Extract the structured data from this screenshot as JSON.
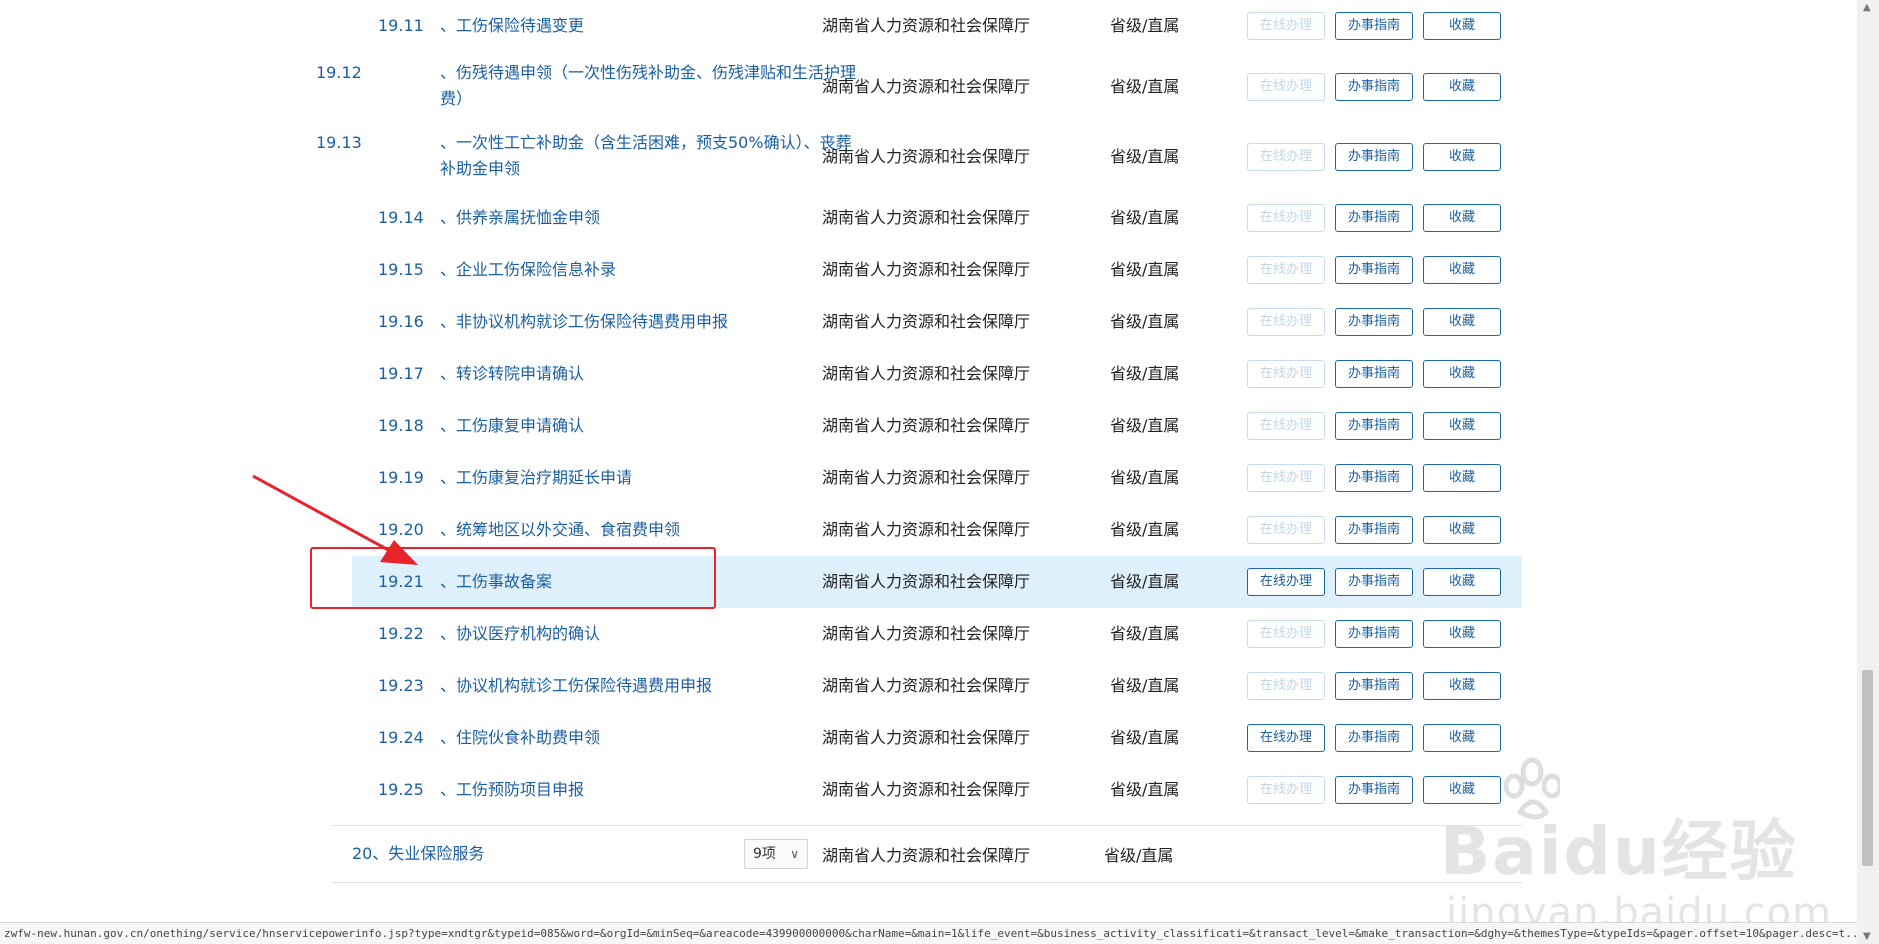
{
  "rows": [
    {
      "num": "19.11",
      "name": "、工伤保险待遇变更",
      "dept": "湖南省人力资源和社会保障厅",
      "level": "省级/直属",
      "online": "在线办理",
      "online_enabled": false,
      "guide": "办事指南",
      "fav": "收藏"
    },
    {
      "num": "19.12",
      "name": "、伤残待遇申领（一次性伤残补助金、伤残津贴和生活护理费）",
      "dept": "湖南省人力资源和社会保障厅",
      "level": "省级/直属",
      "online": "在线办理",
      "online_enabled": false,
      "guide": "办事指南",
      "fav": "收藏"
    },
    {
      "num": "19.13",
      "name": "、一次性工亡补助金（含生活困难，预支50%确认）、丧葬补助金申领",
      "dept": "湖南省人力资源和社会保障厅",
      "level": "省级/直属",
      "online": "在线办理",
      "online_enabled": false,
      "guide": "办事指南",
      "fav": "收藏"
    },
    {
      "num": "19.14",
      "name": "、供养亲属抚恤金申领",
      "dept": "湖南省人力资源和社会保障厅",
      "level": "省级/直属",
      "online": "在线办理",
      "online_enabled": false,
      "guide": "办事指南",
      "fav": "收藏"
    },
    {
      "num": "19.15",
      "name": "、企业工伤保险信息补录",
      "dept": "湖南省人力资源和社会保障厅",
      "level": "省级/直属",
      "online": "在线办理",
      "online_enabled": false,
      "guide": "办事指南",
      "fav": "收藏"
    },
    {
      "num": "19.16",
      "name": "、非协议机构就诊工伤保险待遇费用申报",
      "dept": "湖南省人力资源和社会保障厅",
      "level": "省级/直属",
      "online": "在线办理",
      "online_enabled": false,
      "guide": "办事指南",
      "fav": "收藏"
    },
    {
      "num": "19.17",
      "name": "、转诊转院申请确认",
      "dept": "湖南省人力资源和社会保障厅",
      "level": "省级/直属",
      "online": "在线办理",
      "online_enabled": false,
      "guide": "办事指南",
      "fav": "收藏"
    },
    {
      "num": "19.18",
      "name": "、工伤康复申请确认",
      "dept": "湖南省人力资源和社会保障厅",
      "level": "省级/直属",
      "online": "在线办理",
      "online_enabled": false,
      "guide": "办事指南",
      "fav": "收藏"
    },
    {
      "num": "19.19",
      "name": "、工伤康复治疗期延长申请",
      "dept": "湖南省人力资源和社会保障厅",
      "level": "省级/直属",
      "online": "在线办理",
      "online_enabled": false,
      "guide": "办事指南",
      "fav": "收藏"
    },
    {
      "num": "19.20",
      "name": "、统筹地区以外交通、食宿费申领",
      "dept": "湖南省人力资源和社会保障厅",
      "level": "省级/直属",
      "online": "在线办理",
      "online_enabled": false,
      "guide": "办事指南",
      "fav": "收藏"
    },
    {
      "num": "19.21",
      "name": "、工伤事故备案",
      "dept": "湖南省人力资源和社会保障厅",
      "level": "省级/直属",
      "online": "在线办理",
      "online_enabled": true,
      "guide": "办事指南",
      "fav": "收藏"
    },
    {
      "num": "19.22",
      "name": "、协议医疗机构的确认",
      "dept": "湖南省人力资源和社会保障厅",
      "level": "省级/直属",
      "online": "在线办理",
      "online_enabled": false,
      "guide": "办事指南",
      "fav": "收藏"
    },
    {
      "num": "19.23",
      "name": "、协议机构就诊工伤保险待遇费用申报",
      "dept": "湖南省人力资源和社会保障厅",
      "level": "省级/直属",
      "online": "在线办理",
      "online_enabled": false,
      "guide": "办事指南",
      "fav": "收藏"
    },
    {
      "num": "19.24",
      "name": "、住院伙食补助费申领",
      "dept": "湖南省人力资源和社会保障厅",
      "level": "省级/直属",
      "online": "在线办理",
      "online_enabled": true,
      "guide": "办事指南",
      "fav": "收藏"
    },
    {
      "num": "19.25",
      "name": "、工伤预防项目申报",
      "dept": "湖南省人力资源和社会保障厅",
      "level": "省级/直属",
      "online": "在线办理",
      "online_enabled": false,
      "guide": "办事指南",
      "fav": "收藏"
    }
  ],
  "group": {
    "title": "20、失业保险服务",
    "count": "9项",
    "dept": "湖南省人力资源和社会保障厅",
    "level": "省级/直属"
  },
  "status_url": "zwfw-new.hunan.gov.cn/onething/service/hnservicepowerinfo.jsp?type=xndtgr&typeid=085&word=&orgId=&minSeq=&areacode=439900000000&charName=&main=1&life_event=&business_activity_classificati=&transact_level=&make_transaction=&dghy=&themesType=&typeIds=&pager.offset=10&pager.desc=t...",
  "watermark": {
    "brand": "Baidu经验",
    "domain": "jingyan.baidu.com"
  },
  "colors": {
    "link": "#1b5fa3",
    "highlight_row": "#dff0fd",
    "annotation_red": "#e8232a"
  }
}
